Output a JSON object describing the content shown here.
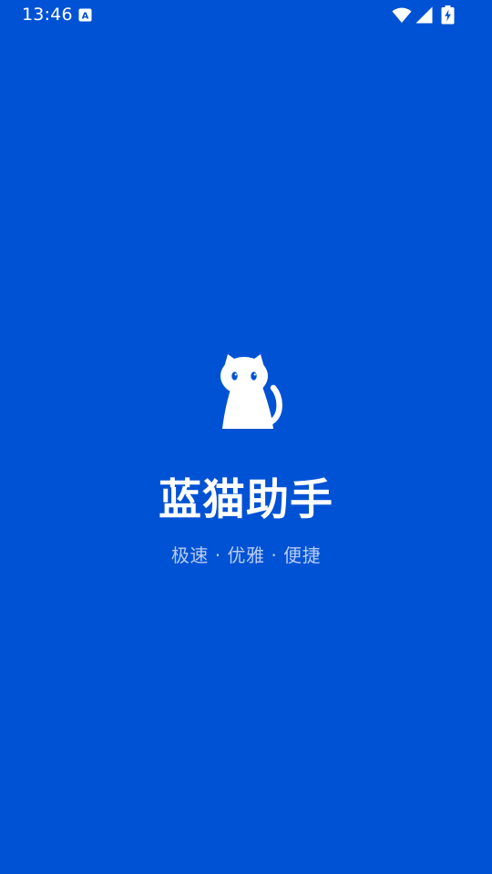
{
  "status_bar": {
    "time": "13:46",
    "notification_icon": "a-notification-icon",
    "wifi_icon": "wifi-icon",
    "signal_icon": "cellular-signal-icon",
    "battery_icon": "battery-charging-icon",
    "notification_letter": "A"
  },
  "splash": {
    "logo_icon": "cat-icon",
    "title": "蓝猫助手",
    "slogan": "极速 · 优雅 · 便捷"
  },
  "colors": {
    "background": "#0052D4",
    "text_primary": "#FFFFFF",
    "text_secondary": "#B9CCF3"
  }
}
